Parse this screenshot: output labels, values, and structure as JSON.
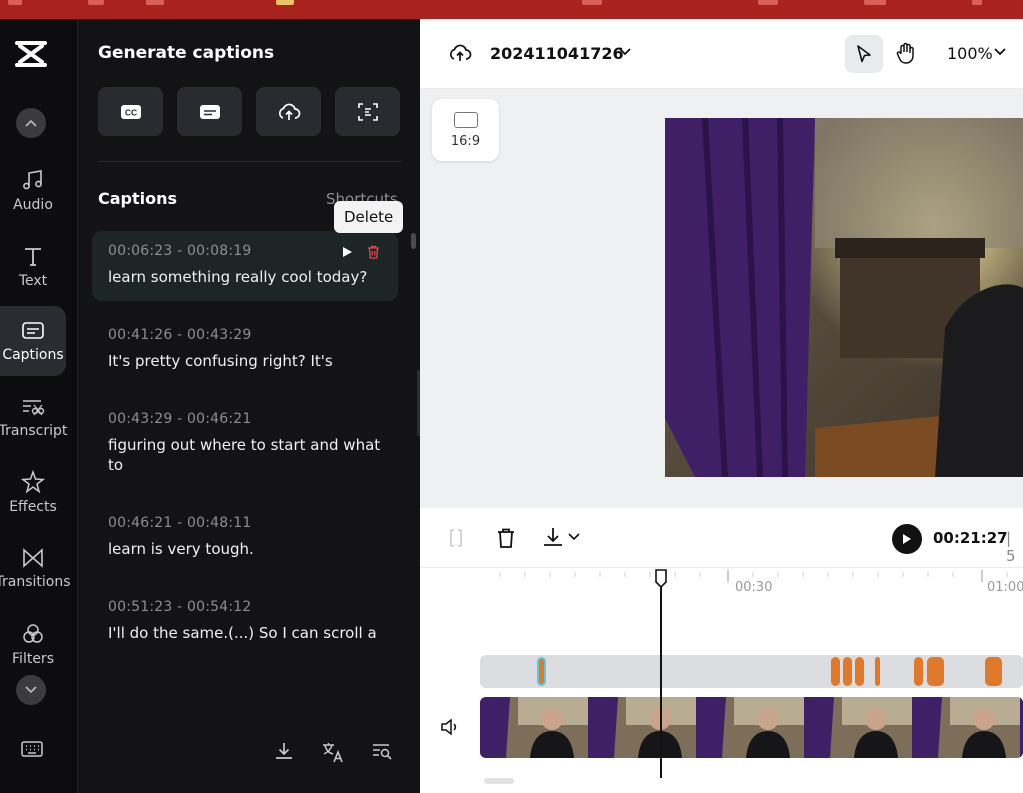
{
  "sidebar": {
    "items": [
      {
        "label": "Audio",
        "icon": "music-note-icon"
      },
      {
        "label": "Text",
        "icon": "text-icon"
      },
      {
        "label": "Captions",
        "icon": "captions-icon",
        "active": true
      },
      {
        "label": "Transcript",
        "icon": "transcript-icon"
      },
      {
        "label": "Effects",
        "icon": "effects-icon"
      },
      {
        "label": "Transitions",
        "icon": "transitions-icon"
      },
      {
        "label": "Filters",
        "icon": "filters-icon"
      }
    ]
  },
  "panel": {
    "title": "Generate captions",
    "section_title": "Captions",
    "shortcuts_label": "Shortcuts",
    "tooltip": "Delete",
    "captions": [
      {
        "time": "00:06:23 - 00:08:19",
        "text": " learn something really cool today?",
        "selected": true
      },
      {
        "time": "00:41:26 - 00:43:29",
        "text": " It's pretty confusing right? It's"
      },
      {
        "time": "00:43:29 - 00:46:21",
        "text": " figuring out where to start and what to"
      },
      {
        "time": "00:46:21 - 00:48:11",
        "text": " learn is very tough."
      },
      {
        "time": "00:51:23 - 00:54:12",
        "text": " I'll do the same.(...) So I can scroll a"
      }
    ]
  },
  "topbar": {
    "project_name": "202411041726",
    "zoom": "100%"
  },
  "canvas": {
    "aspect_ratio": "16:9"
  },
  "timeline": {
    "timecode": "00:21:27",
    "timecode_rest": "| 5",
    "ruler_labels": [
      "00:30",
      "01:00"
    ]
  },
  "colors": {
    "accent": "#e07a2a",
    "sidebar_bg": "#0d0d0f",
    "panel_bg": "#131316",
    "delete_red": "#e5484d"
  }
}
